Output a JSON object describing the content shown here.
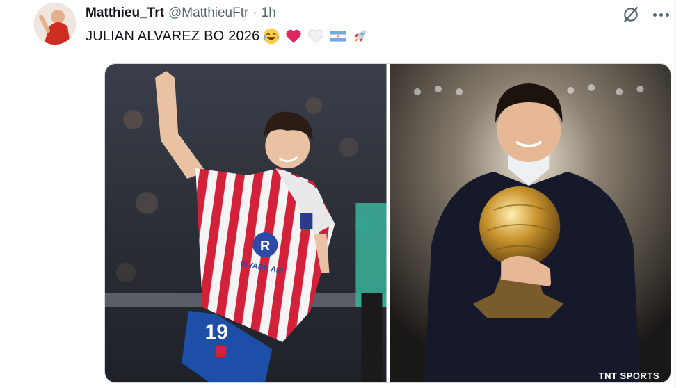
{
  "post": {
    "display_name": "Matthieu_Trt",
    "handle": "@MatthieuFtr",
    "separator": "·",
    "time": "1h",
    "text": "JULIAN ALVAREZ BO 2026",
    "emojis": [
      "joy-emoji",
      "red-heart-emoji",
      "white-heart-emoji",
      "argentina-flag-emoji",
      "rocket-emoji"
    ]
  },
  "media": {
    "photos": [
      {
        "name": "player-celebration-photo",
        "jersey_number": "19",
        "sponsor": "RIYADH AIR"
      },
      {
        "name": "ballon-dor-trophy-photo",
        "watermark": "TNT SPORTS"
      }
    ]
  },
  "icons": {
    "grok": "grok-icon",
    "more": "more-options-icon"
  },
  "colors": {
    "text_primary": "#0f1419",
    "text_secondary": "#536471",
    "border": "#cfd9de",
    "heart_red": "#e0245e"
  }
}
